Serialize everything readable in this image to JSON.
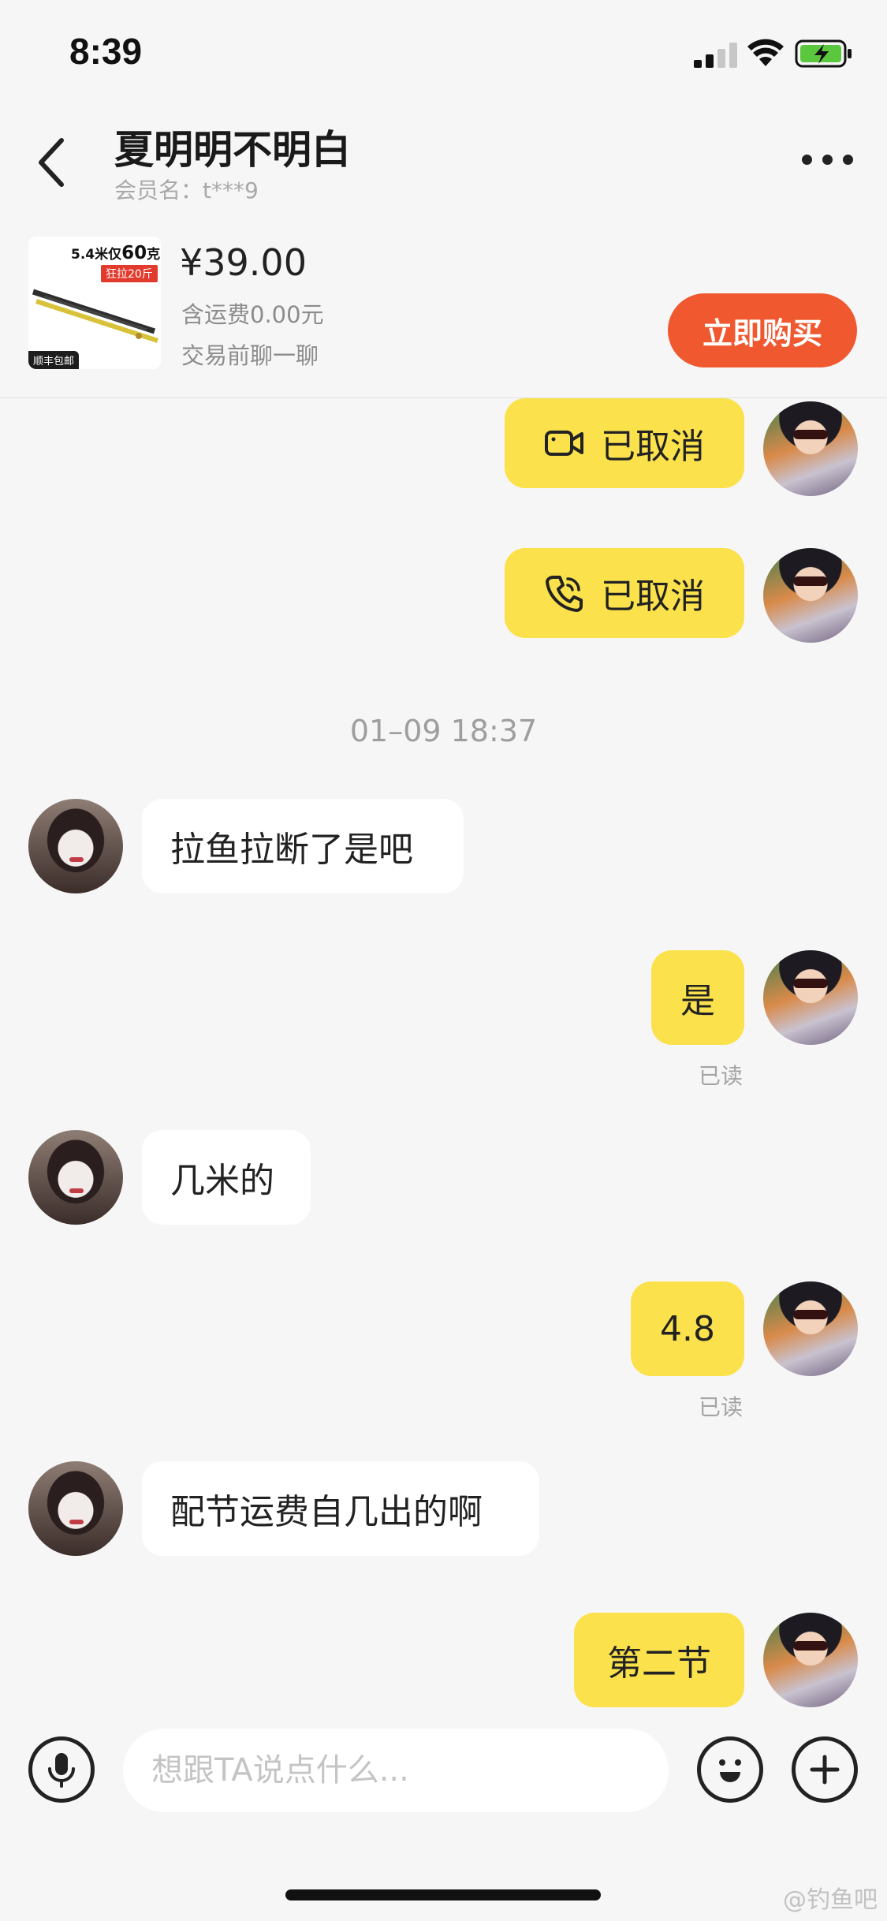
{
  "status_bar": {
    "time": "8:39"
  },
  "header": {
    "contact_name": "夏明明不明白",
    "member_label": "会员名：t***9"
  },
  "product": {
    "thumb_title_prefix": "5.4米仅",
    "thumb_title_num": "60",
    "thumb_title_suffix": "克",
    "thumb_tag": "狂拉20斤",
    "thumb_badge": "顺丰包邮",
    "price": "¥39.00",
    "shipping": "含运费0.00元",
    "note": "交易前聊一聊",
    "buy_label": "立即购买"
  },
  "chat": {
    "timestamp": "01–09 18:37",
    "video_call": {
      "icon": "video-camera-icon",
      "text": "已取消"
    },
    "voice_call": {
      "icon": "phone-icon",
      "text": "已取消"
    },
    "messages": [
      {
        "from": "her",
        "text": "拉鱼拉断了是吧"
      },
      {
        "from": "me",
        "text": "是",
        "status": "已读"
      },
      {
        "from": "her",
        "text": "几米的"
      },
      {
        "from": "me",
        "text": "4.8",
        "status": "已读"
      },
      {
        "from": "her",
        "text": "配节运费自几出的啊"
      },
      {
        "from": "me",
        "text": "第二节"
      }
    ]
  },
  "input": {
    "placeholder": "想跟TA说点什么...",
    "voice_icon": "microphone-icon",
    "emoji_icon": "emoji-icon",
    "plus_icon": "plus-icon"
  },
  "watermark": "@钓鱼吧",
  "colors": {
    "sent_bubble": "#fbe24c",
    "received_bubble": "#ffffff",
    "buy_button": "#f0582f",
    "background": "#f6f6f6"
  }
}
